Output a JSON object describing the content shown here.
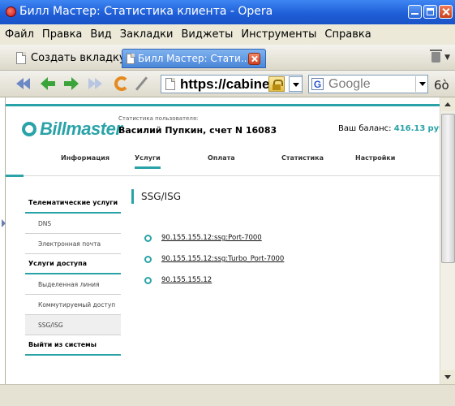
{
  "window": {
    "title": "Билл Мастер: Статистика клиента - Opera"
  },
  "menu": [
    "Файл",
    "Правка",
    "Вид",
    "Закладки",
    "Виджеты",
    "Инструменты",
    "Справка"
  ],
  "tabs": {
    "new_tab_label": "Создать вкладку",
    "active_tab_title": "Билл Мастер: Стати..."
  },
  "toolbar": {
    "url": "https://cabinet",
    "search_placeholder": "Google",
    "search_engine_letter": "G",
    "glasses_glyph": "6ò"
  },
  "site": {
    "logo_text": "Billmaster",
    "user_caption": "Статистика пользователя:",
    "user_name": "Василий Пупкин, счет N 16083",
    "balance_label": "Ваш баланс:",
    "balance_amount": "416.13",
    "balance_currency": "руб.",
    "nav": [
      "Информация",
      "Услуги",
      "Оплата",
      "Статистика",
      "Настройки"
    ],
    "active_nav": "Услуги",
    "accent_color": "#2aa3a8"
  },
  "sidebar": {
    "items": [
      {
        "label": "Телематические услуги",
        "type": "section"
      },
      {
        "label": "DNS",
        "type": "sub"
      },
      {
        "label": "Электронная почта",
        "type": "sub"
      },
      {
        "label": "Услуги доступа",
        "type": "section"
      },
      {
        "label": "Выделенная линия",
        "type": "sub"
      },
      {
        "label": "Коммутируемый доступ",
        "type": "sub"
      },
      {
        "label": "SSG/ISG",
        "type": "sub",
        "current": true
      },
      {
        "label": "Выйти из системы",
        "type": "section"
      }
    ]
  },
  "content": {
    "title": "SSG/ISG",
    "links": [
      "90.155.155.12:ssg:Port-7000",
      "90.155.155.12:ssg:Turbo_Port-7000",
      "90.155.155.12"
    ]
  }
}
